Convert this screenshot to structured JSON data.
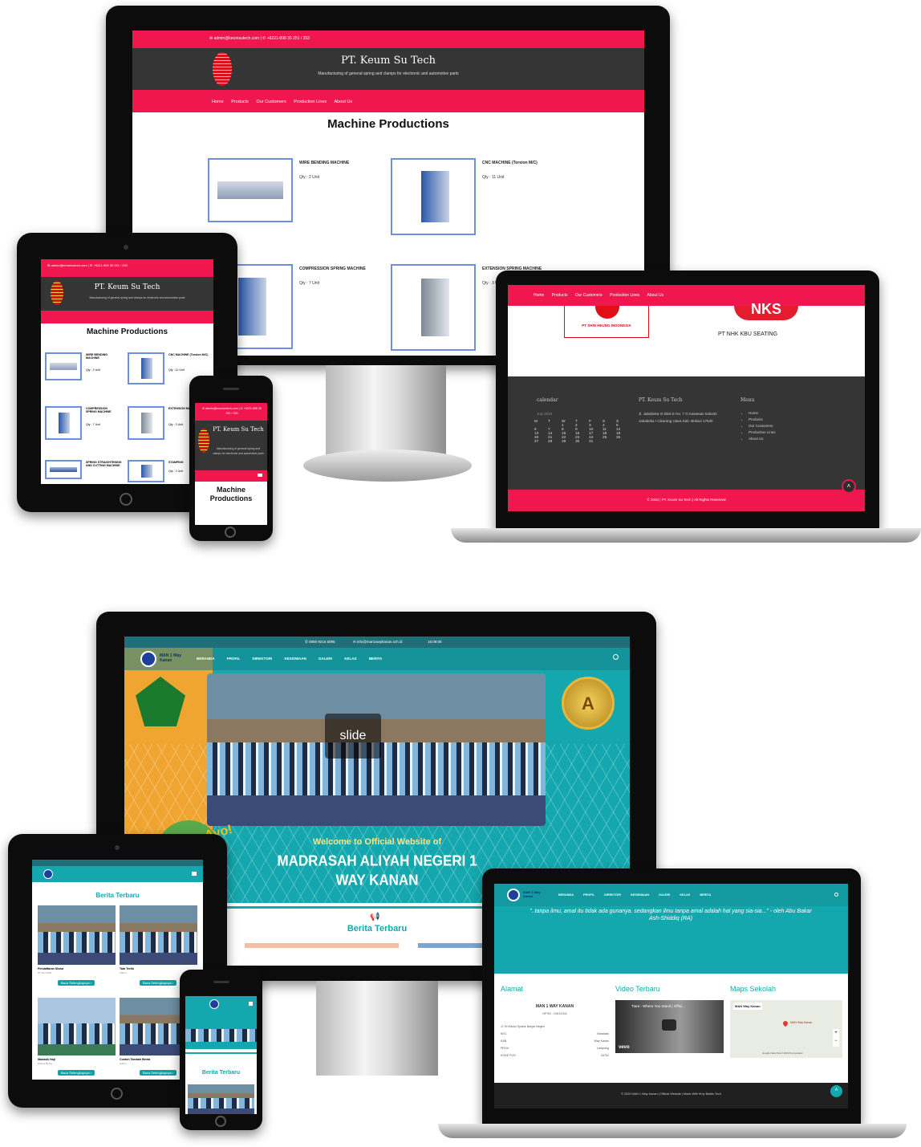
{
  "mock1": {
    "topbar_contact": "✉ admin@keumsutech.com | ✆ +6221-898 35 251 / 253",
    "company_name": "PT. Keum Su Tech",
    "tagline": "Manufacturing of general spring and clamps for electronic and automotive parts",
    "nav": [
      "Home",
      "Products",
      "Our Customers",
      "Production Lines",
      "About Us"
    ],
    "page_title": "Machine Productions",
    "products": [
      {
        "name": "WIRE BENDING MACHINE",
        "qty": "Qty : 2 Unit"
      },
      {
        "name": "CNC MACHINE (Torsion M/C)",
        "qty": "Qty : 11 Unit"
      },
      {
        "name": "COMPRESSION SPRING MACHINE",
        "qty": "Qty : 7 Unit"
      },
      {
        "name": "EXTENSION SPRING MACHINE",
        "qty": "Qty : 3 Unit"
      }
    ],
    "laptop": {
      "customer_left": "PT SHIN HEUNG INDONESIA",
      "customer_right_logo": "NKS",
      "customer_right": "PT NHK KBU SEATING",
      "calendar_title": "calendar",
      "month": "July 2020",
      "weekdays": [
        "M",
        "T",
        "W",
        "T",
        "F",
        "S",
        "S"
      ],
      "weeks": [
        [
          "",
          "",
          "1",
          "2",
          "3",
          "4",
          "5"
        ],
        [
          "6",
          "7",
          "8",
          "9",
          "10",
          "11",
          "12"
        ],
        [
          "13",
          "14",
          "15",
          "16",
          "17",
          "18",
          "19"
        ],
        [
          "20",
          "21",
          "22",
          "23",
          "24",
          "25",
          "26"
        ],
        [
          "27",
          "28",
          "29",
          "30",
          "31",
          "",
          ""
        ]
      ],
      "address_title": "PT. Keum Su Tech",
      "address": "Jl. Jababeka IX Blok E No. 7 G Kawasan Industri Jababeka I Cikarang Utara Kab. Bekasi 17530",
      "menu_title": "Menu",
      "copyright": "© 2020 | PT. Keum Su Tech | All Rights Reserved"
    },
    "tablet_products": [
      {
        "name": "WIRE BENDING MACHINE",
        "qty": "Qty : 2 Unit"
      },
      {
        "name": "CNC MACHINE (Torsion M/C)",
        "qty": "Qty : 11 Unit"
      },
      {
        "name": "COMPRESSION SPRING MACHINE",
        "qty": "Qty : 7 Unit"
      },
      {
        "name": "EXTENSION MACHINE",
        "qty": "Qty : 3 Unit"
      },
      {
        "name": "SPRING STRAIGHTENING AND CUTTING MACHINE",
        "qty": ""
      },
      {
        "name": "STAMPING",
        "qty": "Qty : 2 Unit"
      }
    ]
  },
  "mock2": {
    "topbar_phone": "✆ 0858 9215 5095",
    "topbar_email": "✉ info@man1waykanan.sch.id",
    "topbar_time": "16:08:06",
    "school_short": "MAN 1 Way Kanan",
    "nav": [
      "BERANDA",
      "PROFIL",
      "DIREKTORI",
      "KESISWAAN",
      "GALERI",
      "KELAS",
      "BERITA"
    ],
    "slide_label": "slide",
    "ayo": "Ayo!",
    "welcome": "Welcome to Official Website of",
    "school_line1": "MADRASAH ALIYAH NEGERI 1",
    "school_line2": "WAY KANAN",
    "badge": "TERAKREDITASI",
    "badge_letter": "A",
    "news_title": "Berita Terbaru",
    "quote": "\"..tanpa ilmu, amal itu tidak ada gunanya. sedangkan ilmu tanpa amal adalah hal yang sia-sia...\" - oleh Abu Bakar Ash-Shiddiq (RA)",
    "address_title": "Alamat",
    "school_full": "MAN 1 WAY KANAN",
    "npsn": "NPSN : 10816302",
    "address_rows": [
      [
        "Jl. KH Abdul Syukur Banjar Negeri",
        ""
      ],
      [
        "KEC.",
        "Baradatu"
      ],
      [
        "KAB.",
        "Way Kanan"
      ],
      [
        "PROV.",
        "Lampung"
      ],
      [
        "KODE POS",
        "34761"
      ]
    ],
    "video_title": "Video Terbaru",
    "video_caption": "Tiara - Where You Stand | Offici...",
    "video_brand": "vevo",
    "maps_title": "Maps Sekolah",
    "map_place": "MAN Way Kanan",
    "map_link": "Lihat peta lebih besar",
    "map_pin": "MAN Way Kanan",
    "map_footer": "Google  Data Peta ©2020   Persyaratan",
    "footer": "© 2020 MAN 1 Way Kanan | Official Website | Made With ♥ by Baktis Tech",
    "tablet_news": [
      {
        "title": "Pendaftaran Siswa",
        "date": "25 Juni 2020",
        "button": "Baca Selengkapnya ›"
      },
      {
        "title": "Tata Tertib",
        "date": "Admin",
        "button": "Baca Selengkapnya ›"
      },
      {
        "title": "Manasik Haji",
        "date": "Dibaca Berita",
        "button": "Baca Selengkapnya ›"
      },
      {
        "title": "Contoh Tambah Berita",
        "date": "Admin",
        "button": "Baca Selengkapnya ›"
      }
    ],
    "phone_small_title": "Berita Terbaru"
  }
}
